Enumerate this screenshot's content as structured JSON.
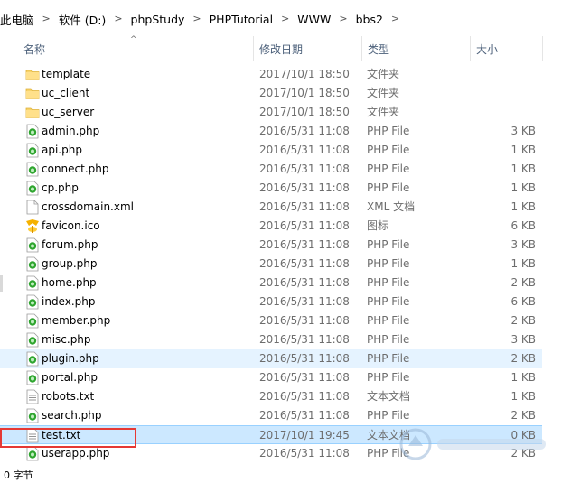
{
  "breadcrumb": [
    "此电脑",
    "软件 (D:)",
    "phpStudy",
    "PHPTutorial",
    "WWW",
    "bbs2"
  ],
  "columns": {
    "name": "名称",
    "modified": "修改日期",
    "type": "类型",
    "size": "大小"
  },
  "files": [
    {
      "name": "template",
      "modified": "2017/10/1 18:50",
      "type": "文件夹",
      "size": "",
      "icon": "folder-icon"
    },
    {
      "name": "uc_client",
      "modified": "2017/10/1 18:50",
      "type": "文件夹",
      "size": "",
      "icon": "folder-icon"
    },
    {
      "name": "uc_server",
      "modified": "2017/10/1 18:50",
      "type": "文件夹",
      "size": "",
      "icon": "folder-icon"
    },
    {
      "name": "admin.php",
      "modified": "2016/5/31 11:08",
      "type": "PHP File",
      "size": "3 KB",
      "icon": "php-file-icon"
    },
    {
      "name": "api.php",
      "modified": "2016/5/31 11:08",
      "type": "PHP File",
      "size": "1 KB",
      "icon": "php-file-icon"
    },
    {
      "name": "connect.php",
      "modified": "2016/5/31 11:08",
      "type": "PHP File",
      "size": "1 KB",
      "icon": "php-file-icon"
    },
    {
      "name": "cp.php",
      "modified": "2016/5/31 11:08",
      "type": "PHP File",
      "size": "1 KB",
      "icon": "php-file-icon"
    },
    {
      "name": "crossdomain.xml",
      "modified": "2016/5/31 11:08",
      "type": "XML 文档",
      "size": "1 KB",
      "icon": "xml-file-icon"
    },
    {
      "name": "favicon.ico",
      "modified": "2016/5/31 11:08",
      "type": "图标",
      "size": "6 KB",
      "icon": "favicon-icon"
    },
    {
      "name": "forum.php",
      "modified": "2016/5/31 11:08",
      "type": "PHP File",
      "size": "3 KB",
      "icon": "php-file-icon"
    },
    {
      "name": "group.php",
      "modified": "2016/5/31 11:08",
      "type": "PHP File",
      "size": "1 KB",
      "icon": "php-file-icon"
    },
    {
      "name": "home.php",
      "modified": "2016/5/31 11:08",
      "type": "PHP File",
      "size": "2 KB",
      "icon": "php-file-icon"
    },
    {
      "name": "index.php",
      "modified": "2016/5/31 11:08",
      "type": "PHP File",
      "size": "6 KB",
      "icon": "php-file-icon"
    },
    {
      "name": "member.php",
      "modified": "2016/5/31 11:08",
      "type": "PHP File",
      "size": "2 KB",
      "icon": "php-file-icon"
    },
    {
      "name": "misc.php",
      "modified": "2016/5/31 11:08",
      "type": "PHP File",
      "size": "3 KB",
      "icon": "php-file-icon"
    },
    {
      "name": "plugin.php",
      "modified": "2016/5/31 11:08",
      "type": "PHP File",
      "size": "2 KB",
      "icon": "php-file-icon",
      "state": "hover"
    },
    {
      "name": "portal.php",
      "modified": "2016/5/31 11:08",
      "type": "PHP File",
      "size": "1 KB",
      "icon": "php-file-icon"
    },
    {
      "name": "robots.txt",
      "modified": "2016/5/31 11:08",
      "type": "文本文档",
      "size": "1 KB",
      "icon": "text-file-icon"
    },
    {
      "name": "search.php",
      "modified": "2016/5/31 11:08",
      "type": "PHP File",
      "size": "2 KB",
      "icon": "php-file-icon"
    },
    {
      "name": "test.txt",
      "modified": "2017/10/1 19:45",
      "type": "文本文档",
      "size": "0 KB",
      "icon": "text-file-icon",
      "state": "selected"
    },
    {
      "name": "userapp.php",
      "modified": "2016/5/31 11:08",
      "type": "PHP File",
      "size": "2 KB",
      "icon": "php-file-icon"
    }
  ],
  "status": {
    "text": "0 字节"
  }
}
